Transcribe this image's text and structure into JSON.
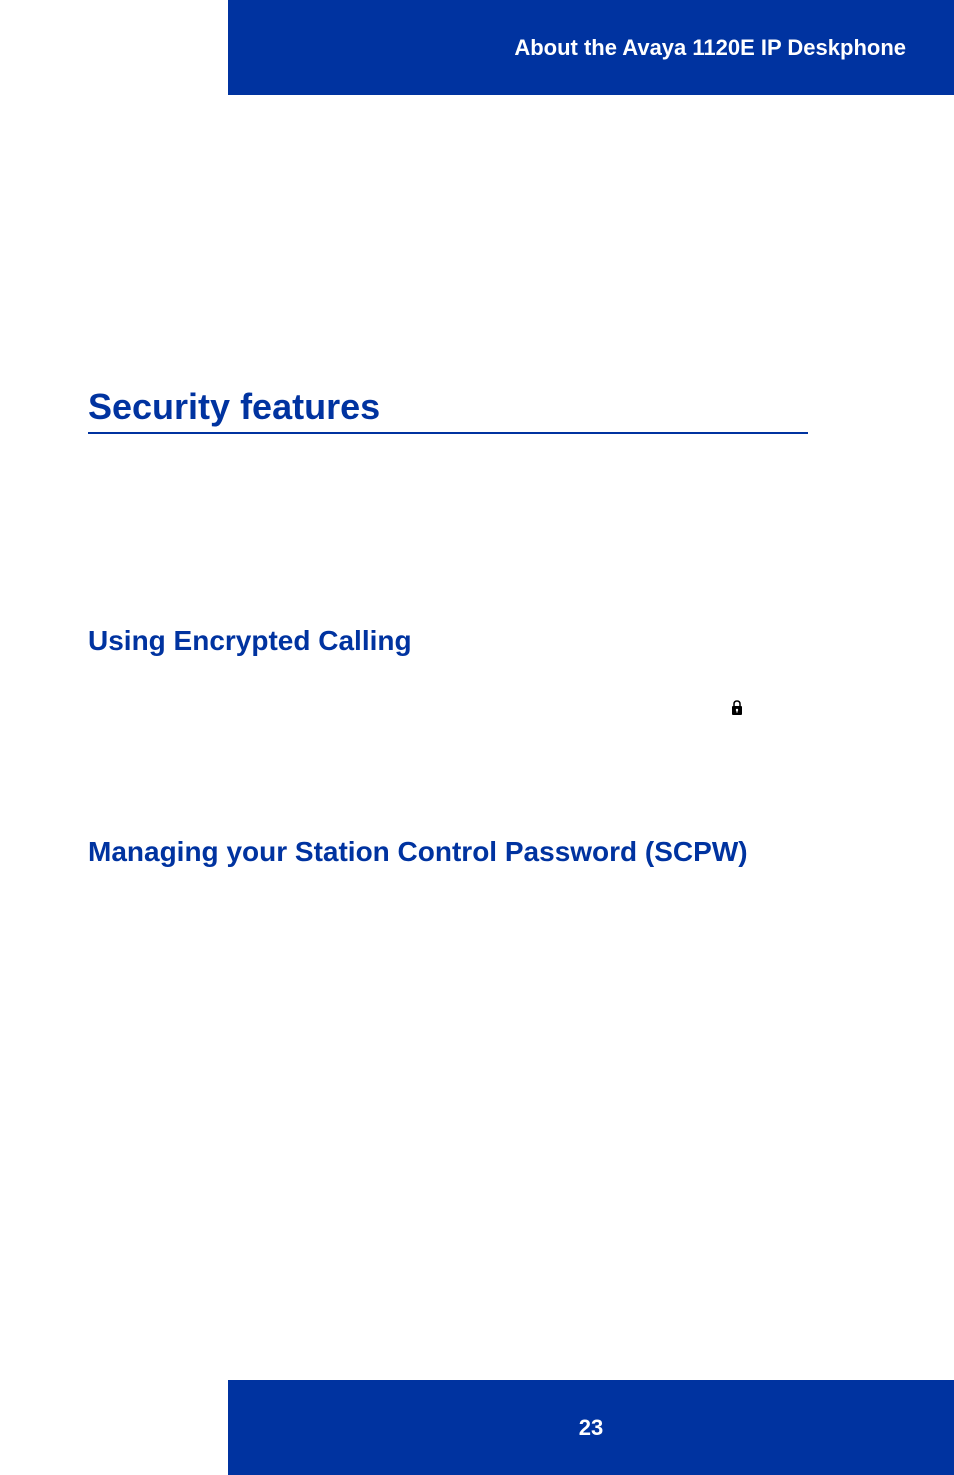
{
  "header": {
    "title": "About the Avaya 1120E IP Deskphone"
  },
  "sections": {
    "main_title": "Security features",
    "sub1": "Using Encrypted Calling",
    "sub2": "Managing your Station Control Password (SCPW)"
  },
  "footer": {
    "page_number": "23"
  }
}
